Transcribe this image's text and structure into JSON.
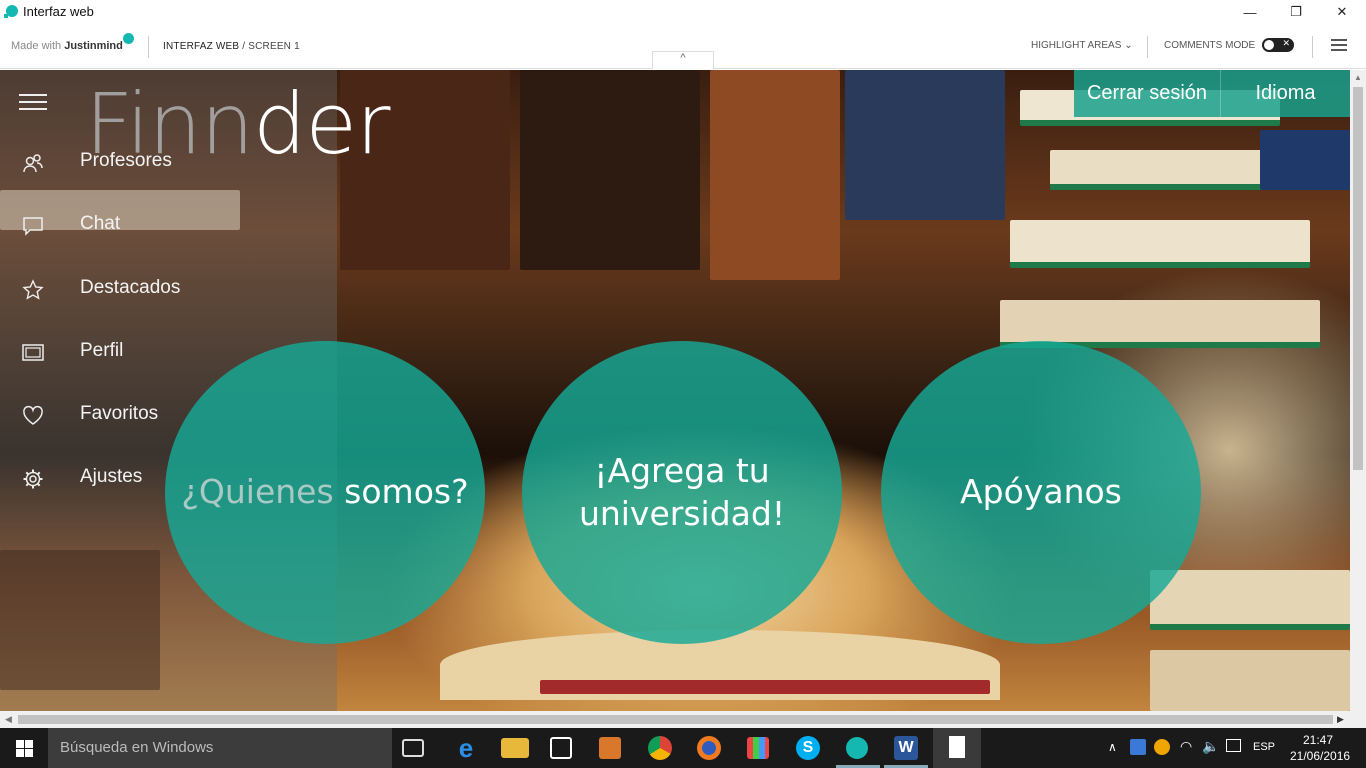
{
  "window": {
    "title": "Interfaz web",
    "minimize": "—",
    "restore": "❐",
    "close": "✕"
  },
  "toolbar": {
    "made_with": "Made with ",
    "brand": "Justinmind",
    "crumb_project": "INTERFAZ WEB",
    "crumb_screen": " / SCREEN 1",
    "highlight": "HIGHLIGHT AREAS",
    "comments": "COMMENTS MODE",
    "collapse": "^"
  },
  "app": {
    "logo_dim": "Finn",
    "logo_rest": "der",
    "nav": [
      {
        "label": "Profesores",
        "icon": "users-icon"
      },
      {
        "label": "Chat",
        "icon": "chat-icon"
      },
      {
        "label": "Destacados",
        "icon": "star-icon"
      },
      {
        "label": "Perfil",
        "icon": "profile-card-icon"
      },
      {
        "label": "Favoritos",
        "icon": "heart-icon"
      },
      {
        "label": "Ajustes",
        "icon": "gear-icon"
      }
    ],
    "logout": "Cerrar sesión",
    "language": "Idioma",
    "circle1_dim": "¿Quienes",
    "circle1_rest": " somos?",
    "circle2": "¡Agrega tu universidad!",
    "circle3": "Apóyanos",
    "accent": "#1aa08c"
  },
  "taskbar": {
    "search_placeholder": "Búsqueda en Windows",
    "lang": "ESP",
    "time": "21:47",
    "date": "21/06/2016"
  }
}
